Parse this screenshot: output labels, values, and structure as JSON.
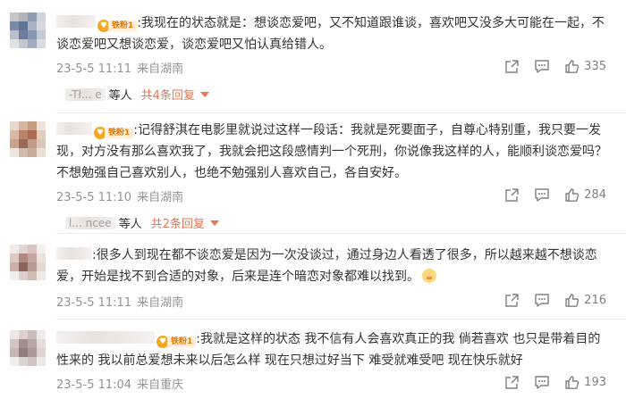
{
  "comments": [
    {
      "nickname": "",
      "has_fan_badge": true,
      "fan_badge_label": "铁粉1",
      "text": ":我现在的状态就是：想谈恋爱吧，又不知道跟谁谈，喜欢吧又没多大可能在一起，不谈恋爱吧又想谈恋爱，谈恋爱吧又怕认真给错人。",
      "date": "23-5-5 11:11",
      "source": "来自湖南",
      "likes": "335",
      "reply_name": "-Tł... e",
      "reply_etc": "等人",
      "reply_count": "共4条回复"
    },
    {
      "nickname": "",
      "has_fan_badge": true,
      "fan_badge_label": "铁粉1",
      "text": ":记得舒淇在电影里就说过这样一段话：我就是死要面子，自尊心特别重，我只要一发现，对方没有那么喜欢我了，我就会把这段感情判一个死刑，你说像我这样的人，能顺利谈恋爱吗？不想勉强自己喜欢别人，也绝不勉强别人喜欢自己，各自安好。",
      "date": "23-5-5 11:10",
      "source": "来自湖南",
      "likes": "284",
      "reply_name": "l... ncee",
      "reply_etc": "等人",
      "reply_count": "共2条回复"
    },
    {
      "nickname": "",
      "has_fan_badge": false,
      "text": ":很多人到现在都不谈恋爱是因为一次没谈过，通过身边人看透了很多，所以越来越不想谈恋爱，开始是找不到合适的对象，后来是连个暗恋对象都难以找到。",
      "date": "23-5-5 11:11",
      "source": "来自湖南",
      "likes": "216"
    },
    {
      "nickname": "",
      "has_fan_badge": true,
      "fan_badge_label": "铁粉1",
      "text": ":我就是这样的状态 我不信有人会喜欢真正的我 倘若喜欢 也只是带着目的性来的 我以前总爱想未来以后怎么样 现在只想过好当下 难受就难受吧 现在快乐就好",
      "date": "23-5-5 11:04",
      "source": "来自重庆",
      "likes": "193"
    }
  ],
  "icons": {
    "share": "share-icon",
    "comment": "comment-icon",
    "like": "thumbs-up-icon",
    "reply_caret": "caret-down-icon",
    "emoji": "face-emoji-icon"
  },
  "colors": {
    "accent": "#eb7350",
    "meta_text": "#939393",
    "fan_badge": "#f5a623"
  }
}
